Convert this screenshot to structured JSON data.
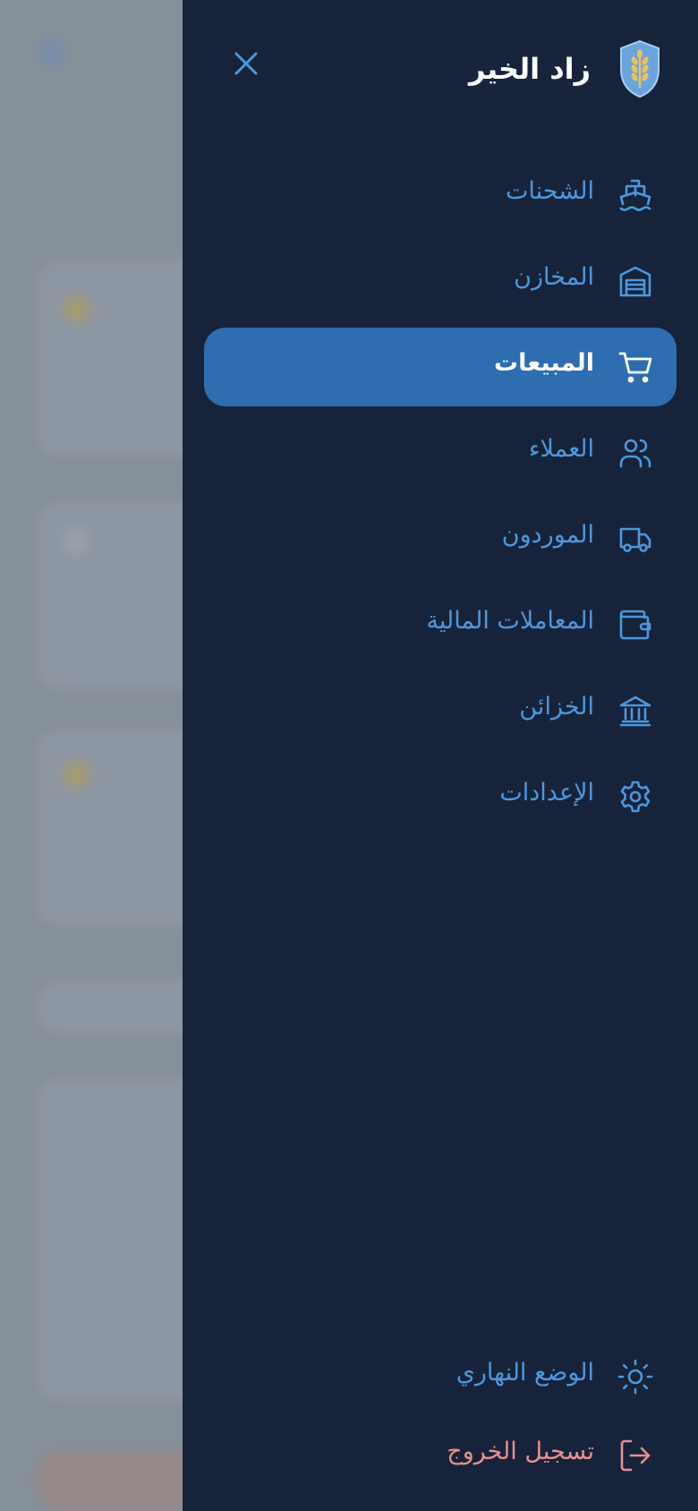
{
  "app": {
    "name": "زاد الخير"
  },
  "nav": {
    "items": [
      {
        "label": "الشحنات",
        "icon": "ship-icon"
      },
      {
        "label": "المخازن",
        "icon": "warehouse-icon"
      },
      {
        "label": "المبيعات",
        "icon": "cart-icon",
        "active": true
      },
      {
        "label": "العملاء",
        "icon": "users-icon"
      },
      {
        "label": "الموردون",
        "icon": "truck-icon"
      },
      {
        "label": "المعاملات المالية",
        "icon": "wallet-icon"
      },
      {
        "label": "الخزائن",
        "icon": "bank-icon"
      },
      {
        "label": "الإعدادات",
        "icon": "gear-icon"
      }
    ]
  },
  "bottom": {
    "theme_label": "الوضع النهاري",
    "logout_label": "تسجيل الخروج"
  },
  "colors": {
    "drawer_bg": "#17233a",
    "accent": "#2e6db0",
    "link": "#4d98de",
    "logout": "#e89090"
  }
}
